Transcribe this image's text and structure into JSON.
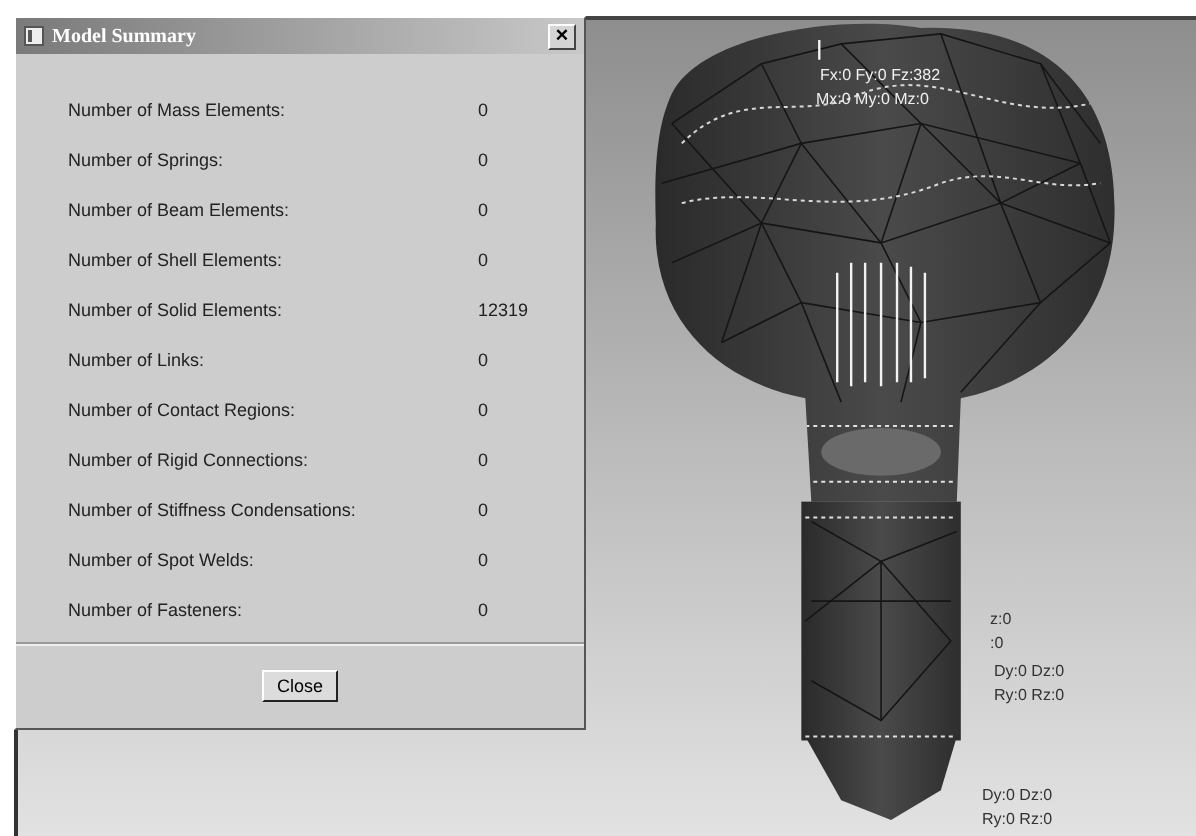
{
  "dialog": {
    "title": "Model Summary",
    "close_icon": "×",
    "rows": [
      {
        "label": "Number of Mass Elements:",
        "value": "0"
      },
      {
        "label": "Number of Springs:",
        "value": "0"
      },
      {
        "label": "Number of Beam Elements:",
        "value": "0"
      },
      {
        "label": "Number of Shell Elements:",
        "value": "0"
      },
      {
        "label": "Number of Solid Elements:",
        "value": "12319"
      },
      {
        "label": "Number of Links:",
        "value": "0"
      },
      {
        "label": "Number of Contact Regions:",
        "value": "0"
      },
      {
        "label": "Number of Rigid Connections:",
        "value": "0"
      },
      {
        "label": "Number of Stiffness Condensations:",
        "value": "0"
      },
      {
        "label": "Number of Spot Welds:",
        "value": "0"
      },
      {
        "label": "Number of Fasteners:",
        "value": "0"
      }
    ],
    "button": "Close"
  },
  "viewport": {
    "labels": [
      "Fx:0 Fy:0 Fz:382",
      "Mx:0 My:0 Mz:0",
      "z:0",
      ":0",
      "Dy:0 Dz:0",
      "Ry:0 Rz:0",
      "Dy:0 Dz:0",
      "Ry:0 Rz:0"
    ]
  }
}
